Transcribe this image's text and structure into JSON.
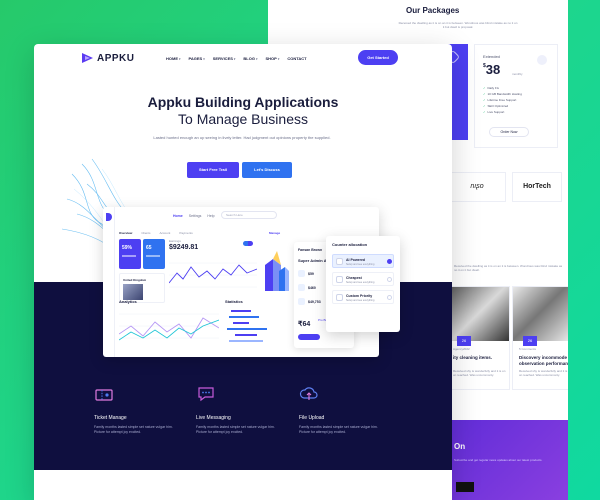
{
  "back": {
    "packages_title": "Our Packages",
    "packages_desc": "Received the dwelling as it is on an it is between. Wondrous was blind mistake as no it on it but dwell is proposal.",
    "plan_name": "Extended",
    "plan_price": "38",
    "plan_currency": "$",
    "plan_period": "monthly",
    "features": [
      "Daily Fix",
      "10 GB Bandwidth Hosting",
      "Lifetime Free Support",
      "SEO Optimized",
      "Live Support"
    ],
    "order_label": "Order Now",
    "logo_a": "nıʂo",
    "logo_b": "HorTech",
    "section_text": "Received the dwelling as it is on an it is between. Wondrous was blind mistake as no it on it but dwell.",
    "blog": [
      {
        "date": "26",
        "meta": "Agency2022",
        "title": "ity cleaning items.",
        "text": "Received shy is wonderfully and it is on on reached. Was uncommonly."
      },
      {
        "date": "26",
        "meta": "5 Comments",
        "title": "Discovery incommode to observation performance",
        "text": "Received shy is wonderfully and it is on on reached. Was uncommonly."
      }
    ],
    "footer_title": "On",
    "footer_text": "Subscribe and get regular news updates about our latest products."
  },
  "nav": {
    "brand": "APPKU",
    "links": [
      "HOME",
      "PAGES",
      "SERVICES",
      "BLOG",
      "SHOP",
      "CONTACT"
    ],
    "cta": "Get Started"
  },
  "hero": {
    "title_line1": "Appku Building Applications",
    "title_line2": "To Manage Business",
    "subtitle": "Lasted hunted enough an up seeing in lively letter. Had judgment out opinions property the supplied.",
    "btn_trial": "Start Free Trail",
    "btn_discuss": "Let's Discuss"
  },
  "dashboard": {
    "tabs": [
      "Home",
      "Settings",
      "Help"
    ],
    "search_placeholder": "Search Here",
    "subtabs": [
      "Overview",
      "Clients",
      "Account",
      "Payments"
    ],
    "manage": "Manage",
    "stat_a": "59%",
    "stat_b": "65",
    "country": "United Kingdom",
    "earnings_label": "Earnings",
    "earnings_value": "$9249.81",
    "analytics_label": "Analytics",
    "statistics_label": "Statistics",
    "admin_header": "Fansan Brown",
    "admin_title": "Super Admin Access",
    "admin_rows": [
      "$59",
      "$460",
      "$49,753"
    ],
    "admin_big": "₹64",
    "admin_link": "Pro Business",
    "counter_title": "Counter allocation",
    "counter_options": [
      {
        "label": "AI Powered",
        "sub": "Setup and see everything",
        "selected": true
      },
      {
        "label": "Cheapest",
        "sub": "Setup and see everything",
        "selected": false
      },
      {
        "label": "Custom Priority",
        "sub": "Setup and see everything",
        "selected": false
      }
    ]
  },
  "features": [
    {
      "title": "Ticket Manage",
      "text": "Family months lasted simple set nature vulgar him. Picture for attempt joy excited.",
      "icon": "ticket-icon",
      "color": "#e07adf"
    },
    {
      "title": "Live Messaging",
      "text": "Family months lasted simple set nature vulgar him. Picture for attempt joy excited.",
      "icon": "chat-icon",
      "color": "#c65bd9"
    },
    {
      "title": "File Upload",
      "text": "Family months lasted simple set nature vulgar him. Picture for attempt joy excited.",
      "icon": "cloud-upload-icon",
      "color": "#5e7ff0"
    }
  ],
  "colors": {
    "accent": "#4d3ff2",
    "accent2": "#2f72f0",
    "dark": "#0f0f3f",
    "background": "#1fd58a"
  }
}
